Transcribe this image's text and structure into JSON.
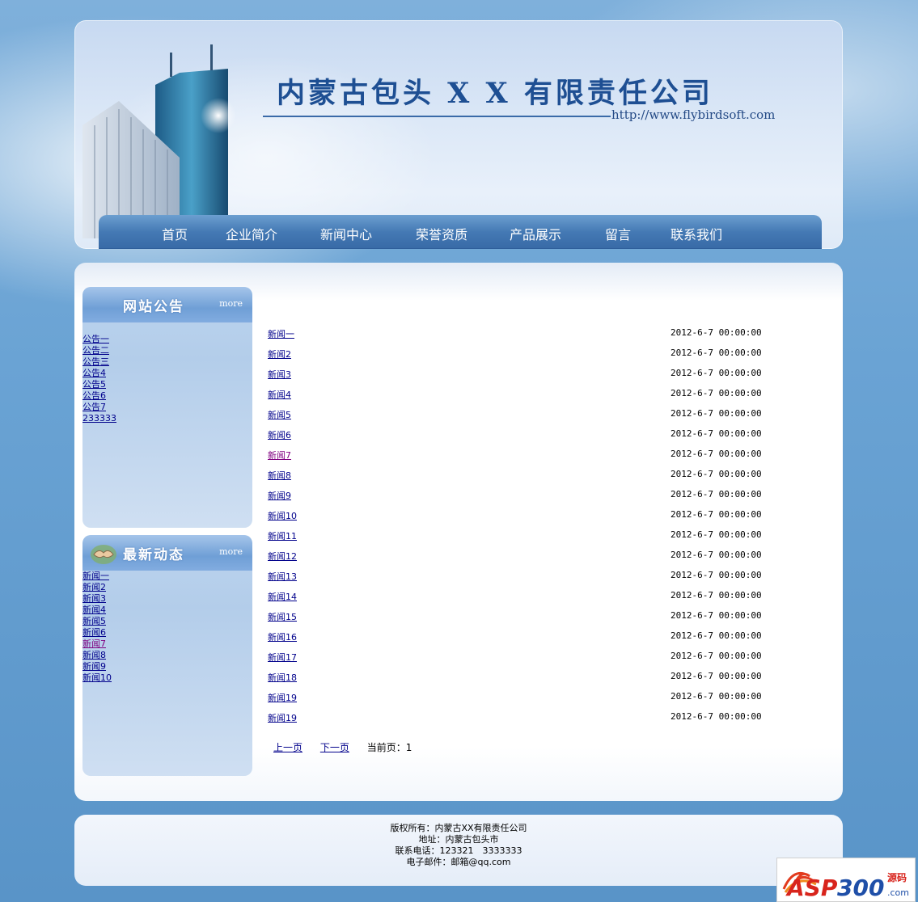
{
  "header": {
    "company_title": "内蒙古包头 X X 有限责任公司",
    "url": "http://www.flybirdsoft.com"
  },
  "nav": [
    "首页",
    "企业简介",
    "新闻中心",
    "荣誉资质",
    "产品展示",
    "留言",
    "联系我们"
  ],
  "notice_box": {
    "title": "网站公告",
    "more": "more",
    "items": [
      "公告一",
      "公告二",
      "公告三",
      "公告4",
      "公告5",
      "公告6",
      "公告7",
      "233333"
    ]
  },
  "latest_box": {
    "title": "最新动态",
    "more": "more",
    "items": [
      "新闻一",
      "新闻2",
      "新闻3",
      "新闻4",
      "新闻5",
      "新闻6",
      "新闻7",
      "新闻8",
      "新闻9",
      "新闻10"
    ]
  },
  "news_list": [
    {
      "title": "新闻一",
      "date": "2012-6-7 00:00:00"
    },
    {
      "title": "新闻2",
      "date": "2012-6-7 00:00:00"
    },
    {
      "title": "新闻3",
      "date": "2012-6-7 00:00:00"
    },
    {
      "title": "新闻4",
      "date": "2012-6-7 00:00:00"
    },
    {
      "title": "新闻5",
      "date": "2012-6-7 00:00:00"
    },
    {
      "title": "新闻6",
      "date": "2012-6-7 00:00:00"
    },
    {
      "title": "新闻7",
      "date": "2012-6-7 00:00:00"
    },
    {
      "title": "新闻8",
      "date": "2012-6-7 00:00:00"
    },
    {
      "title": "新闻9",
      "date": "2012-6-7 00:00:00"
    },
    {
      "title": "新闻10",
      "date": "2012-6-7 00:00:00"
    },
    {
      "title": "新闻11",
      "date": "2012-6-7 00:00:00"
    },
    {
      "title": "新闻12",
      "date": "2012-6-7 00:00:00"
    },
    {
      "title": "新闻13",
      "date": "2012-6-7 00:00:00"
    },
    {
      "title": "新闻14",
      "date": "2012-6-7 00:00:00"
    },
    {
      "title": "新闻15",
      "date": "2012-6-7 00:00:00"
    },
    {
      "title": "新闻16",
      "date": "2012-6-7 00:00:00"
    },
    {
      "title": "新闻17",
      "date": "2012-6-7 00:00:00"
    },
    {
      "title": "新闻18",
      "date": "2012-6-7 00:00:00"
    },
    {
      "title": "新闻19",
      "date": "2012-6-7 00:00:00"
    },
    {
      "title": "新闻19",
      "date": "2012-6-7 00:00:00"
    }
  ],
  "pager": {
    "prev": "上一页",
    "next": "下一页",
    "current": "当前页：1"
  },
  "footer": {
    "copyright": "版权所有：内蒙古XX有限责任公司",
    "address": "地址：内蒙古包头市",
    "phone": "联系电话：123321　3333333",
    "email": "电子邮件：邮箱@qq.com"
  },
  "watermark_logo": "ASP300 源码 .com",
  "colors": {
    "link": "#00008b",
    "visited_link": "#800080",
    "nav_bar": "#4479b4",
    "title": "#1e4f93"
  }
}
